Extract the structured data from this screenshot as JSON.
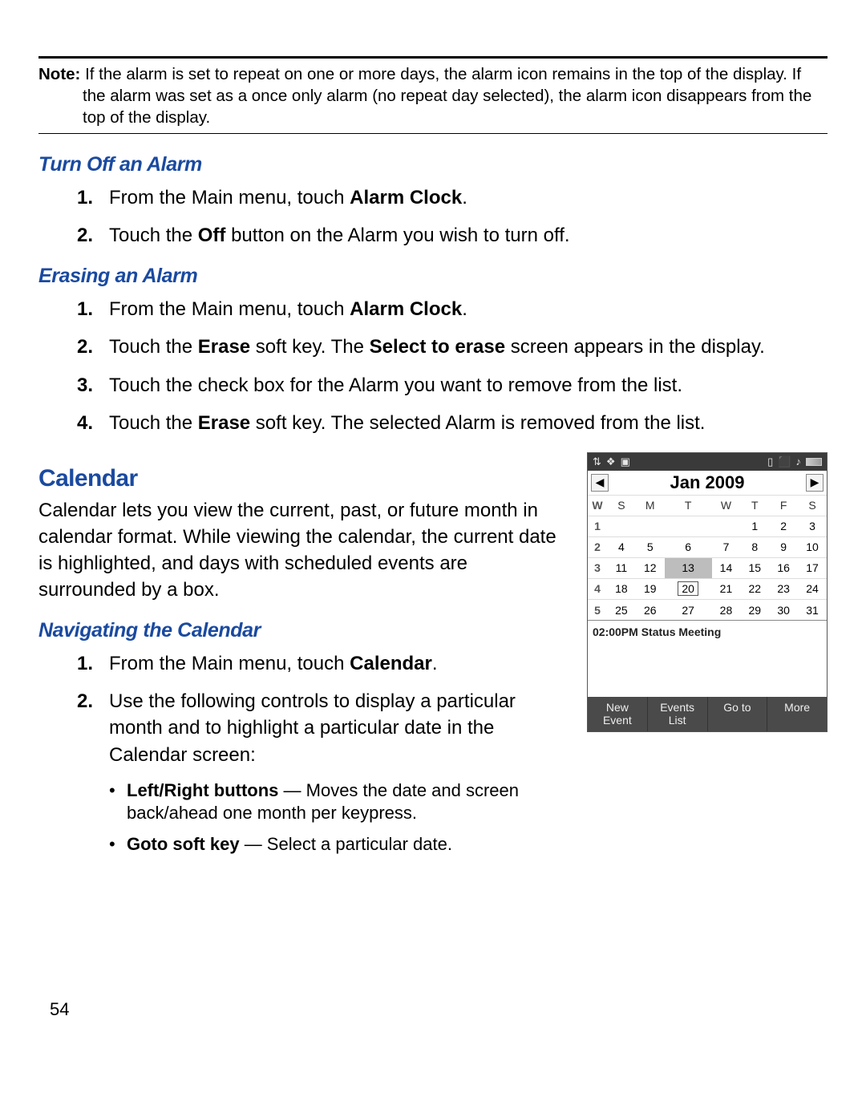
{
  "note": {
    "label": "Note:",
    "text": " If the alarm is set to repeat on one or more days, the alarm icon remains in the top of the display. If the alarm was set as a once only alarm (no repeat day selected), the alarm icon disappears from the top of the display."
  },
  "turn_off": {
    "heading": "Turn Off an Alarm",
    "steps": {
      "s1_pre": "From the Main menu, touch ",
      "s1_b": "Alarm Clock",
      "s1_post": ".",
      "s2_pre": "Touch the ",
      "s2_b": "Off",
      "s2_post": " button on the Alarm you wish to turn off."
    }
  },
  "erasing": {
    "heading": "Erasing an Alarm",
    "steps": {
      "s1_pre": "From the Main menu, touch ",
      "s1_b": "Alarm Clock",
      "s1_post": ".",
      "s2_pre": "Touch the ",
      "s2_b1": "Erase",
      "s2_mid": " soft key. The ",
      "s2_b2": "Select to erase",
      "s2_post": " screen appears in the display.",
      "s3": "Touch the check box for the Alarm you want to remove from the list.",
      "s4_pre": "Touch the ",
      "s4_b": "Erase",
      "s4_post": " soft key. The selected Alarm is removed from the list."
    }
  },
  "calendar": {
    "heading": "Calendar",
    "intro": "Calendar lets you view the current, past, or future month in calendar format. While viewing the calendar, the current date is highlighted, and days with scheduled events are surrounded by a box.",
    "nav_heading": "Navigating the Calendar",
    "steps": {
      "s1_pre": "From the Main menu, touch ",
      "s1_b": "Calendar",
      "s1_post": ".",
      "s2": "Use the following controls to display a particular month and to highlight a particular date in the Calendar screen:"
    },
    "bullets": {
      "b1_b": "Left/Right buttons",
      "b1_rest": " — Moves the date and screen back/ahead one month per keypress.",
      "b2_b": "Goto soft key",
      "b2_rest": " — Select a particular date."
    }
  },
  "phone": {
    "status_left": [
      "⇅",
      "❖",
      "▣"
    ],
    "status_right": [
      "▯",
      "⬛",
      "♪"
    ],
    "month": "Jan 2009",
    "dow": [
      "W",
      "S",
      "M",
      "T",
      "W",
      "T",
      "F",
      "S"
    ],
    "weeks": [
      {
        "w": "1",
        "d": [
          "",
          "",
          "",
          "",
          "1",
          "2",
          "3"
        ]
      },
      {
        "w": "2",
        "d": [
          "4",
          "5",
          "6",
          "7",
          "8",
          "9",
          "10"
        ]
      },
      {
        "w": "3",
        "d": [
          "11",
          "12",
          "13",
          "14",
          "15",
          "16",
          "17"
        ]
      },
      {
        "w": "4",
        "d": [
          "18",
          "19",
          "20",
          "21",
          "22",
          "23",
          "24"
        ]
      },
      {
        "w": "5",
        "d": [
          "25",
          "26",
          "27",
          "28",
          "29",
          "30",
          "31"
        ]
      }
    ],
    "highlight": "13",
    "boxed": "20",
    "event": "02:00PM Status Meeting",
    "softkeys": [
      "New\nEvent",
      "Events\nList",
      "Go to",
      "More"
    ]
  },
  "page_number": "54"
}
